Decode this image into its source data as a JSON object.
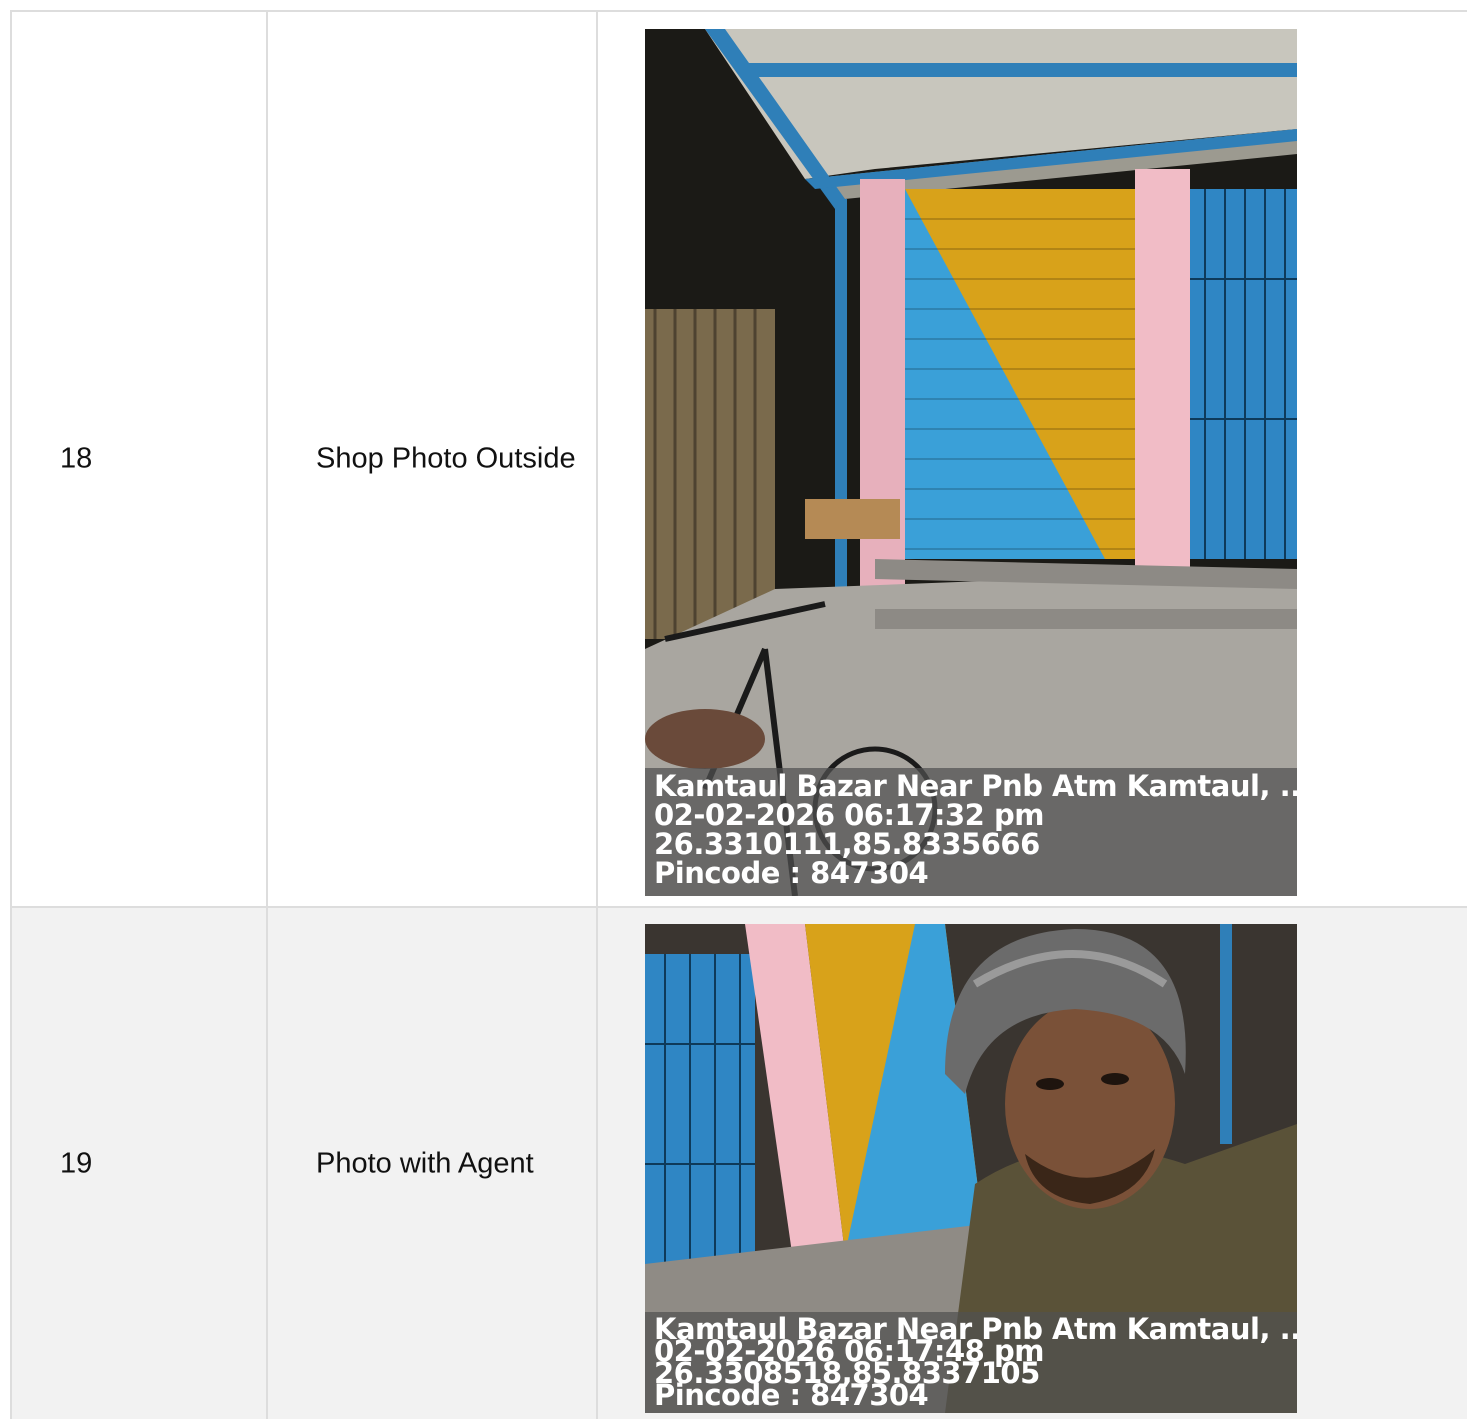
{
  "rows": [
    {
      "number": "18",
      "label": "Shop Photo Outside",
      "photo": {
        "icon": "shop-shutter-photo",
        "stamp": {
          "address": "Kamtaul Bazar Near Pnb Atm Kamtaul, ...",
          "datetime": "02-02-2026 06:17:32 pm",
          "coordinates": "26.3310111,85.8335666",
          "pincode": "Pincode : 847304"
        }
      }
    },
    {
      "number": "19",
      "label": "Photo with Agent",
      "photo": {
        "icon": "agent-selfie-photo",
        "stamp": {
          "address": "Kamtaul Bazar Near Pnb Atm Kamtaul, ...",
          "datetime": "02-02-2026 06:17:48 pm",
          "coordinates": "26.3308518,85.8337105",
          "pincode": "Pincode : 847304"
        }
      }
    }
  ],
  "colors": {
    "border": "#dddddd",
    "alt_row": "#f2f2f2",
    "shutter_blue": "#3aa0d8",
    "shutter_yellow": "#d8a21a",
    "wall_pink": "#f1bcc6"
  }
}
